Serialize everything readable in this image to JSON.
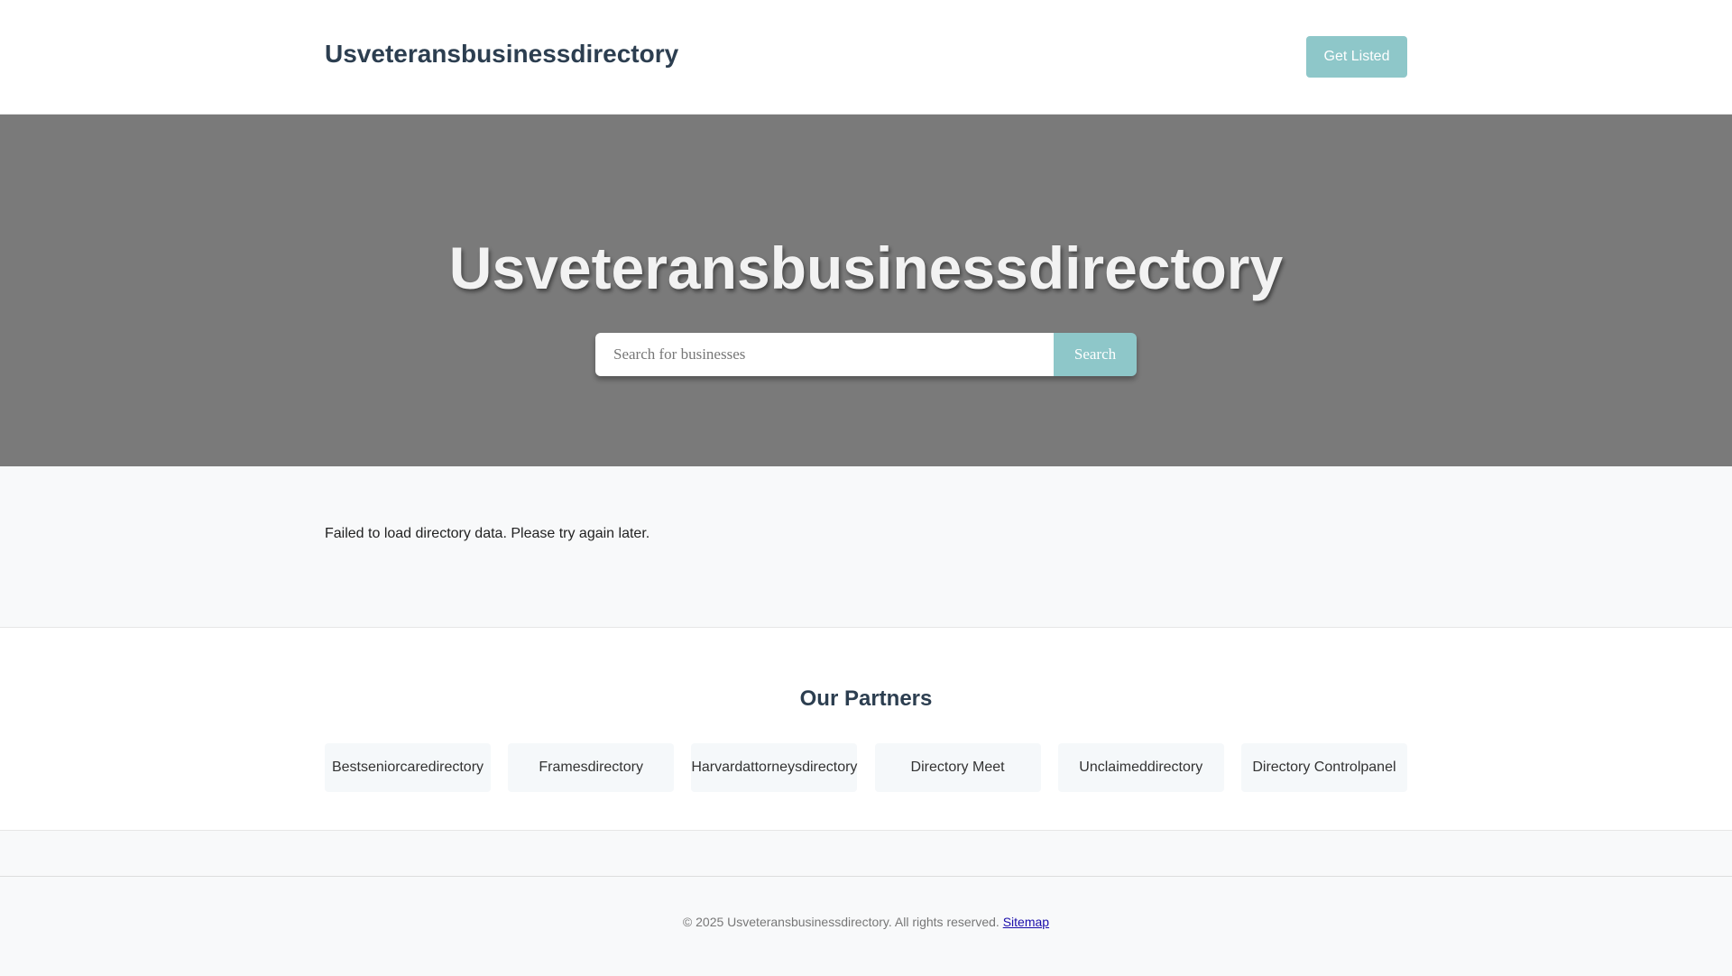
{
  "header": {
    "site_title": "Usveteransbusinessdirectory",
    "get_listed_label": "Get Listed"
  },
  "hero": {
    "title": "Usveteransbusinessdirectory",
    "search_placeholder": "Search for businesses",
    "search_value": "",
    "search_button_label": "Search"
  },
  "message": {
    "error_text": "Failed to load directory data. Please try again later."
  },
  "partners": {
    "title": "Our Partners",
    "items": [
      {
        "label": "Bestseniorcaredirectory"
      },
      {
        "label": "Framesdirectory"
      },
      {
        "label": "Harvardattorneysdirectory"
      },
      {
        "label": "Directory Meet"
      },
      {
        "label": "Unclaimeddirectory"
      },
      {
        "label": "Directory Controlpanel"
      }
    ]
  },
  "footer": {
    "copyright": "© 2025 Usveteransbusinessdirectory. All rights reserved.",
    "sitemap_label": "Sitemap"
  },
  "colors": {
    "brand_text": "#2c3e50",
    "accent": "#8ec7c9",
    "hero_background": "#7a7a7a",
    "page_background": "#f8f9fa",
    "link": "#1a0dab"
  }
}
